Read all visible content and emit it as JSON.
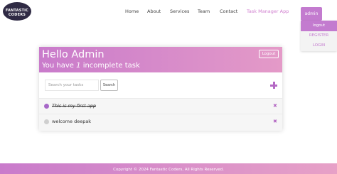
{
  "brand": {
    "logo_text": "FANTASTIC CODERS"
  },
  "nav": {
    "home": "Home",
    "about": "About",
    "services": "Services",
    "team": "Team",
    "contact": "Contact",
    "task_manager": "Task Manager App"
  },
  "account": {
    "admin_label": "admin",
    "menu": {
      "logout": "logout",
      "register": "REGISTER",
      "login": "LOGIN"
    }
  },
  "card": {
    "greeting": "Hello Admin",
    "subtitle_prefix": "You have ",
    "incomplete_count": "1",
    "subtitle_suffix": " incomplete task",
    "logout_label": "Logout",
    "search": {
      "placeholder": "Search your tasks",
      "button_label": "Search"
    },
    "tasks": [
      {
        "label": "This is my first app",
        "completed": true
      },
      {
        "label": "welcome deepak",
        "completed": false
      }
    ],
    "delete_glyph": "✖"
  },
  "footer": {
    "text": "Copyright © 2024 Fantastic Coders, All Rights Reserved."
  },
  "colors": {
    "accent": "#c37bcf",
    "gradient_start": "#c97bcb",
    "gradient_end": "#e49ac8",
    "done_dot": "#a768c8",
    "todo_dot": "#cfcfcf"
  }
}
